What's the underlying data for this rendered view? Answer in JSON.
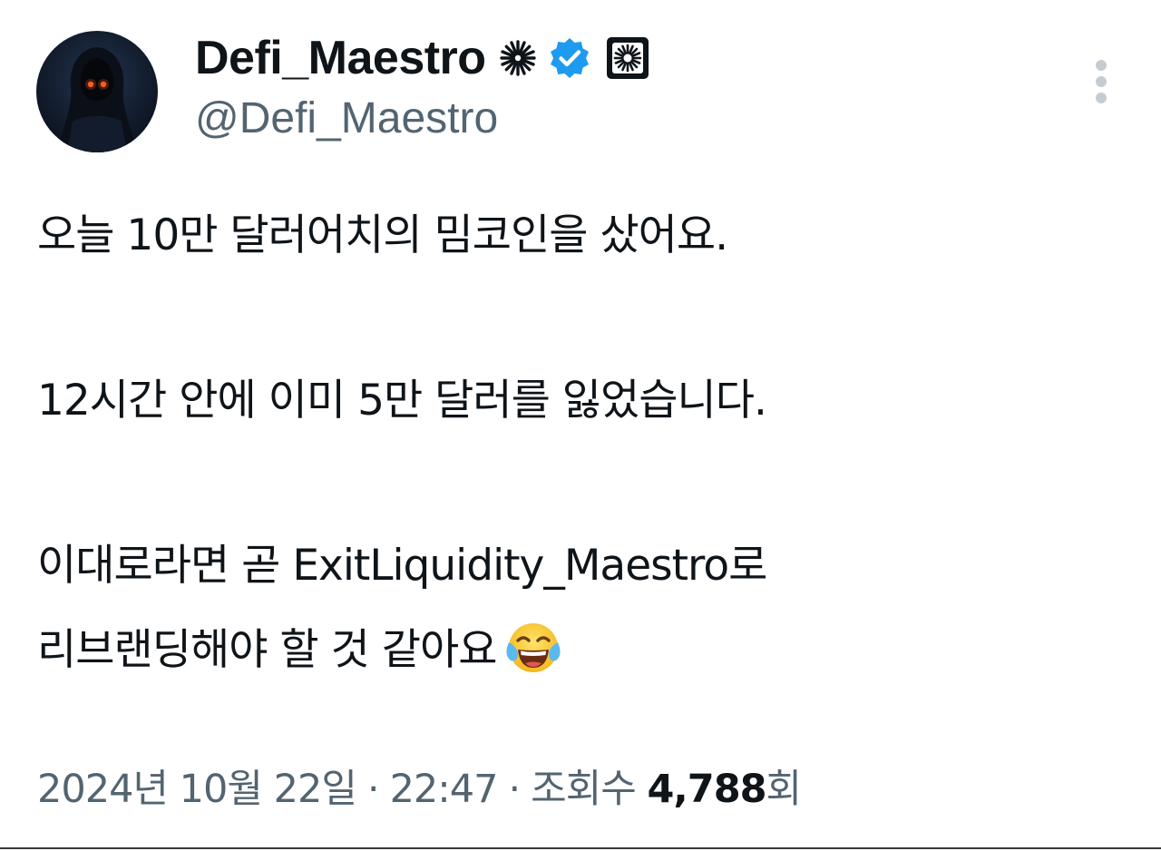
{
  "author": {
    "display_name": "Defi_Maestro",
    "handle": "@Defi_Maestro",
    "badges": [
      "sunburst-icon",
      "verified-badge-icon",
      "affiliate-logo-icon"
    ],
    "verified_color": "#1d9bf0"
  },
  "tweet": {
    "lines": [
      "오늘 10만 달러어치의 밈코인을 샀어요.",
      "12시간 안에 이미 5만 달러를 잃었습니다.",
      "이대로라면 곧 ExitLiquidity_Maestro로",
      "리브랜딩해야 할 것 같아요"
    ],
    "emoji": "tears-of-joy-emoji"
  },
  "meta": {
    "date": "2024년 10월 22일",
    "separator": "·",
    "time": "22:47",
    "views_label": "조회수",
    "views_count": "4,788",
    "views_suffix": "회"
  },
  "colors": {
    "text_primary": "#0f1419",
    "text_secondary": "#536471",
    "verified": "#1d9bf0"
  }
}
